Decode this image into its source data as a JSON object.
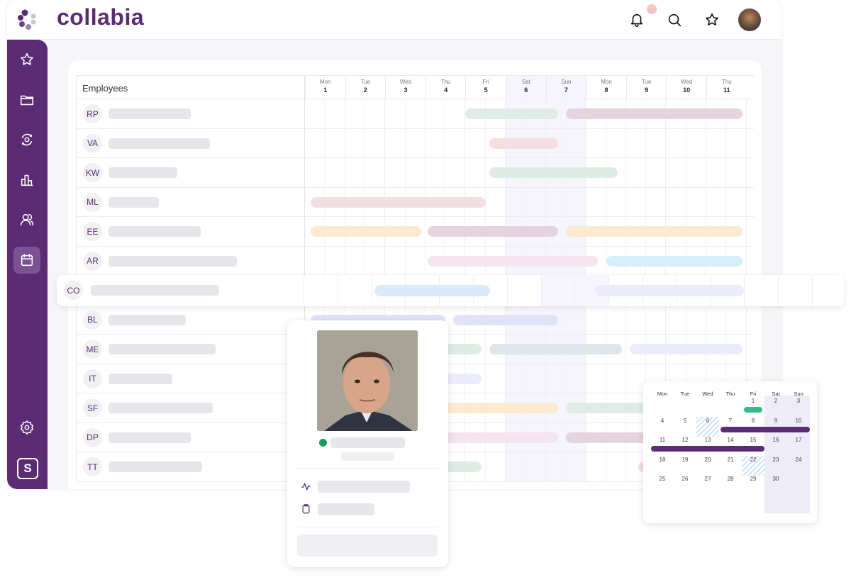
{
  "app": {
    "brand": "collabia",
    "topbar": {
      "icons": [
        "bell-icon",
        "search-icon",
        "star-icon",
        "user-avatar"
      ],
      "has_notification": true
    }
  },
  "sidebar": {
    "items": [
      {
        "name": "favorites",
        "icon": "star-icon",
        "active": false
      },
      {
        "name": "projects",
        "icon": "folder-icon",
        "active": false
      },
      {
        "name": "sync",
        "icon": "sync-icon",
        "active": false
      },
      {
        "name": "reports",
        "icon": "bar-chart-icon",
        "active": false
      },
      {
        "name": "people",
        "icon": "users-icon",
        "active": false
      },
      {
        "name": "calendar",
        "icon": "calendar-icon",
        "active": true
      }
    ],
    "settings_icon": "gear-icon",
    "workspace_badge": "S"
  },
  "schedule": {
    "employees_header": "Employees",
    "days": [
      {
        "name": "Mon",
        "num": "1",
        "weekend": false
      },
      {
        "name": "Tue",
        "num": "2",
        "weekend": false
      },
      {
        "name": "Wed",
        "num": "3",
        "weekend": false
      },
      {
        "name": "Thu",
        "num": "4",
        "weekend": false
      },
      {
        "name": "Fri",
        "num": "5",
        "weekend": false
      },
      {
        "name": "Sat",
        "num": "6",
        "weekend": true
      },
      {
        "name": "Sun",
        "num": "7",
        "weekend": true
      },
      {
        "name": "Mon",
        "num": "8",
        "weekend": false
      },
      {
        "name": "Tue",
        "num": "9",
        "weekend": false
      },
      {
        "name": "Wed",
        "num": "10",
        "weekend": false
      },
      {
        "name": "Thu",
        "num": "11",
        "weekend": false
      }
    ],
    "rows": [
      {
        "initials": "RP",
        "name_len": 0.55,
        "bars": [
          {
            "start": 4,
            "end": 6.3,
            "color": "#dfece6"
          },
          {
            "start": 6.5,
            "end": 10.9,
            "color": "#e4d4de"
          }
        ]
      },
      {
        "initials": "VA",
        "name_len": 0.68,
        "bars": [
          {
            "start": 4.6,
            "end": 6.3,
            "color": "#f3dfe2"
          }
        ]
      },
      {
        "initials": "KW",
        "name_len": 0.46,
        "bars": [
          {
            "start": 4.6,
            "end": 7.8,
            "color": "#dfece6"
          }
        ]
      },
      {
        "initials": "ML",
        "name_len": 0.34,
        "bars": [
          {
            "start": 0.15,
            "end": 4.5,
            "color": "#f3dfe2"
          }
        ]
      },
      {
        "initials": "EE",
        "name_len": 0.62,
        "bars": [
          {
            "start": 0.15,
            "end": 2.9,
            "color": "#fbe9d0"
          },
          {
            "start": 3.05,
            "end": 6.3,
            "color": "#e4d4de"
          },
          {
            "start": 6.5,
            "end": 10.9,
            "color": "#fbe9d0"
          }
        ]
      },
      {
        "initials": "AR",
        "name_len": 0.86,
        "bars": [
          {
            "start": 3.05,
            "end": 7.3,
            "color": "#f3e4ee"
          },
          {
            "start": 7.5,
            "end": 10.9,
            "color": "#d6eef8"
          }
        ]
      },
      {
        "initials": "CO",
        "name_len": 0.86,
        "highlighted": true,
        "bars": [
          {
            "start": 2.1,
            "end": 5.5,
            "color": "#dbeafb"
          },
          {
            "start": 8.6,
            "end": 13.0,
            "color": "#ecebfa"
          }
        ]
      },
      {
        "initials": "BL",
        "name_len": 0.52,
        "bars": [
          {
            "start": 0.15,
            "end": 3.5,
            "color": "#dfe3f7"
          },
          {
            "start": 3.7,
            "end": 6.3,
            "color": "#dfe3f7"
          }
        ]
      },
      {
        "initials": "ME",
        "name_len": 0.72,
        "bars": [
          {
            "start": 3.05,
            "end": 4.4,
            "color": "#dfece6"
          },
          {
            "start": 4.6,
            "end": 7.9,
            "color": "#dde5ea"
          },
          {
            "start": 8.1,
            "end": 10.9,
            "color": "#ecebfa"
          }
        ]
      },
      {
        "initials": "IT",
        "name_len": 0.43,
        "bars": [
          {
            "start": 3.05,
            "end": 4.4,
            "color": "#ecebfa"
          }
        ]
      },
      {
        "initials": "SF",
        "name_len": 0.7,
        "bars": [
          {
            "start": 3.05,
            "end": 6.3,
            "color": "#fbe9d0"
          },
          {
            "start": 6.5,
            "end": 8.6,
            "color": "#dfece6"
          }
        ]
      },
      {
        "initials": "DP",
        "name_len": 0.55,
        "bars": [
          {
            "start": 3.05,
            "end": 6.3,
            "color": "#f3e4ee"
          },
          {
            "start": 6.5,
            "end": 8.6,
            "color": "#e4d4de"
          }
        ]
      },
      {
        "initials": "TT",
        "name_len": 0.63,
        "bars": [
          {
            "start": 3.05,
            "end": 4.4,
            "color": "#dfece6"
          },
          {
            "start": 8.3,
            "end": 8.6,
            "color": "#f3dfe2"
          }
        ]
      }
    ]
  },
  "profile_card": {
    "status": "online",
    "status_color": "#1a9b58",
    "icons": [
      "activity-icon",
      "clipboard-icon"
    ]
  },
  "mini_calendar": {
    "weekdays": [
      "Mon",
      "Tue",
      "Wed",
      "Thu",
      "Fri",
      "Sat",
      "Sun"
    ],
    "first_weekday_index": 4,
    "days_in_month": 30,
    "hatched_days": [
      6,
      22
    ],
    "events": [
      {
        "from": 1,
        "to": 1,
        "color": "#2fbf86"
      },
      {
        "from": 7,
        "to": 10,
        "color": "#5b2c74"
      },
      {
        "from": 11,
        "to": 15,
        "color": "#5b2c74"
      }
    ]
  }
}
